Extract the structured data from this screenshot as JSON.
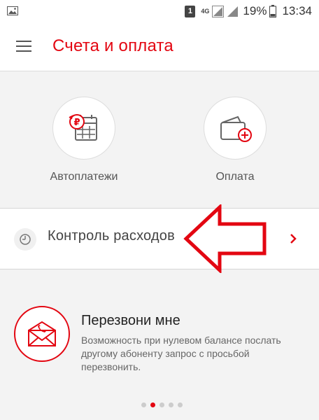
{
  "status_bar": {
    "sim_badge": "1",
    "network": "4G",
    "battery": "19%",
    "time": "13:34"
  },
  "header": {
    "title": "Счета и оплата",
    "menu_icon": "hamburger-menu-icon"
  },
  "quick_actions": [
    {
      "label": "Автоплатежи",
      "icon": "auto-payment-calendar-icon"
    },
    {
      "label": "Оплата",
      "icon": "wallet-add-icon"
    }
  ],
  "expense_control": {
    "label": "Контроль расходов",
    "icon": "clock-icon"
  },
  "callback_promo": {
    "title": "Перезвони мне",
    "description": "Возможность при нулевом балансе послать другому абоненту запрос с просьбой перезвонить.",
    "icon": "envelope-phone-icon"
  },
  "pager": {
    "count": 5,
    "active_index": 1
  },
  "colors": {
    "accent": "#e30611",
    "annotation_arrow": "#e30611"
  }
}
